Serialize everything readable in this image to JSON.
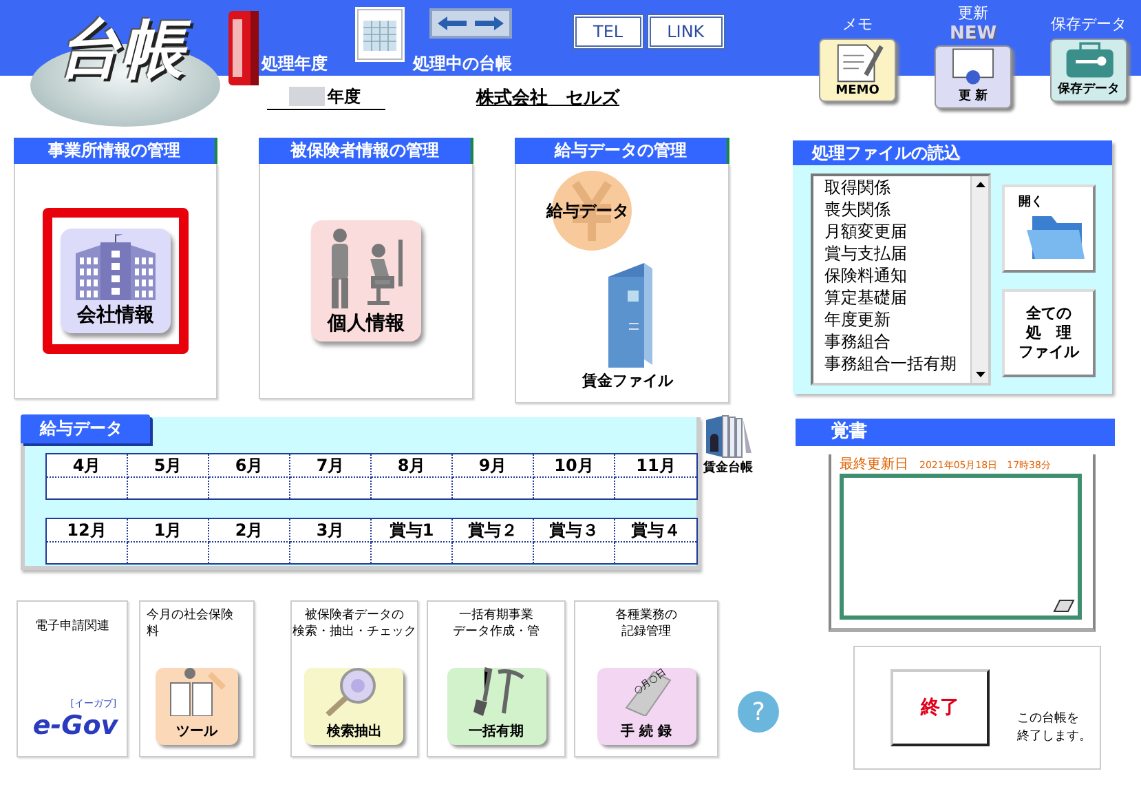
{
  "logo": {
    "title": "台帳"
  },
  "header": {
    "fiscal_year_label": "処理年度",
    "current_ledger_label": "処理中の台帳",
    "link_buttons": [
      "TEL",
      "LINK"
    ],
    "tools": [
      {
        "kind": "memo",
        "caption": "メモ",
        "label": "MEMO"
      },
      {
        "kind": "update",
        "caption": "更新",
        "label": "更 新",
        "badge": "NEW"
      },
      {
        "kind": "save",
        "caption": "保存データ",
        "label": "保存データ"
      }
    ],
    "year_suffix": "年度",
    "company_name": "株式会社　セルズ"
  },
  "sections": [
    {
      "title": "事業所情報の管理",
      "tiles": [
        {
          "kind": "building",
          "label": "会社情報",
          "selected": true
        }
      ]
    },
    {
      "title": "被保険者情報の管理",
      "tiles": [
        {
          "kind": "people",
          "label": "個人情報",
          "selected": false
        }
      ]
    },
    {
      "title": "給与データの管理",
      "tiles": [
        {
          "kind": "yen",
          "label": "給与データ",
          "selected": false
        },
        {
          "kind": "binder",
          "label": "賃金ファイル",
          "selected": false
        }
      ]
    }
  ],
  "file_reader": {
    "title": "処理ファイルの読込",
    "items": [
      "取得関係",
      "喪失関係",
      "月額変更届",
      "賞与支払届",
      "保険料通知",
      "算定基礎届",
      "年度更新",
      "事務組合",
      "事務組合一括有期"
    ],
    "open_button": "開く",
    "all_files_button": [
      "全ての",
      "処　理",
      "ファイル"
    ]
  },
  "salary_data": {
    "title": "給与データ",
    "rows": [
      [
        "4月",
        "5月",
        "6月",
        "7月",
        "8月",
        "9月",
        "10月",
        "11月"
      ],
      [
        "12月",
        "1月",
        "2月",
        "3月",
        "賞与1",
        "賞与２",
        "賞与３",
        "賞与４"
      ]
    ],
    "ledger_label": "賃金台帳"
  },
  "memo": {
    "title": "覚書",
    "updated_label": "最終更新日",
    "updated_value": "2021年05月18日　17時38分"
  },
  "bottom_tools": [
    {
      "kind": "egov",
      "caption": [
        "電子申請関連"
      ],
      "label": "e-Gov",
      "sublabel": "[イーガブ]"
    },
    {
      "kind": "tool",
      "caption": [
        "今月の社会保険",
        "料"
      ],
      "label": "ツール"
    },
    {
      "kind": "search",
      "caption": [
        "被保険者データの",
        "検索・抽出・チェック"
      ],
      "label": "検索抽出"
    },
    {
      "kind": "dig",
      "caption": [
        "一括有期事業",
        "データ作成・管"
      ],
      "label": "一括有期"
    },
    {
      "kind": "record",
      "caption": [
        "各種業務の",
        "記録管理"
      ],
      "label": "手 続 録",
      "icon_text": "○月○日"
    }
  ],
  "help": "?",
  "exit": {
    "button": "終了",
    "note": [
      "この台帳を",
      "終了します。"
    ]
  }
}
